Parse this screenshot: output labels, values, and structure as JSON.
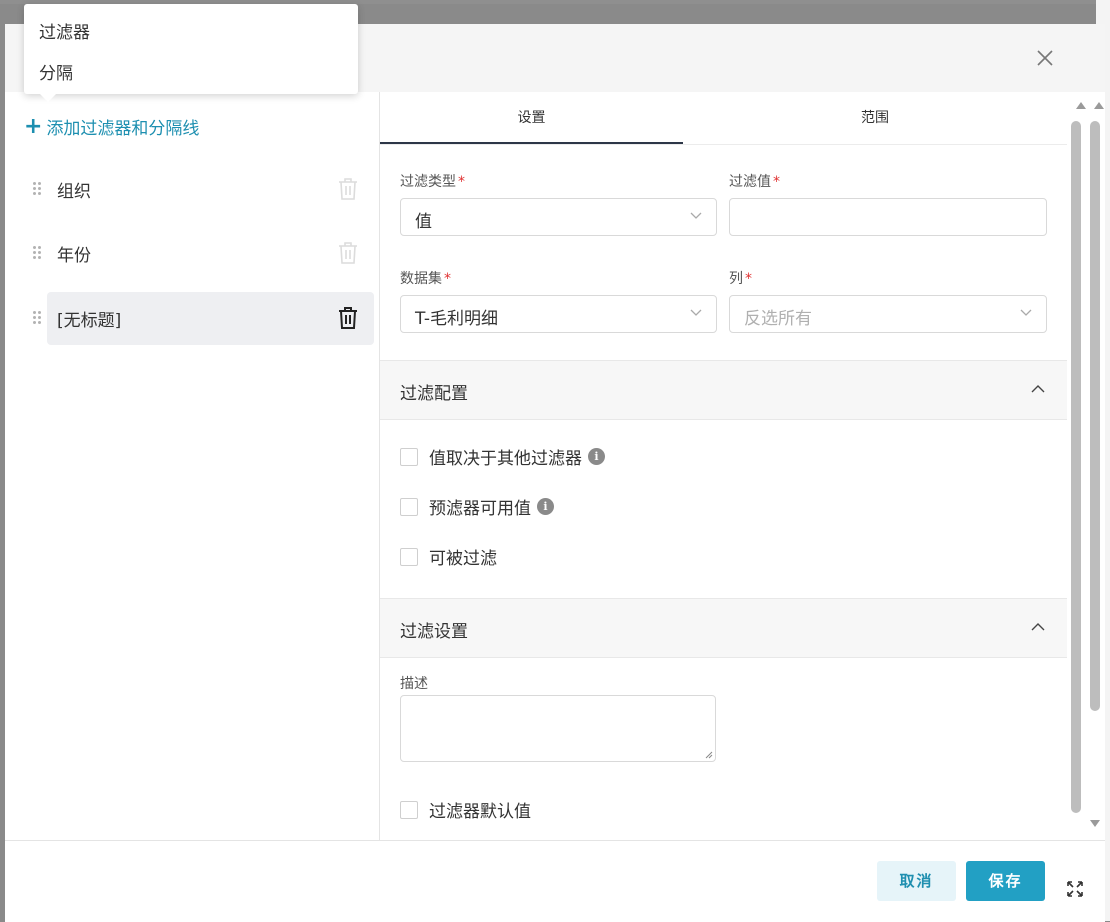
{
  "dialog": {
    "left_panel": {
      "add_link": "添加过滤器和分隔线",
      "items": [
        {
          "label": "组织"
        },
        {
          "label": "年份"
        },
        {
          "label": "[无标题]"
        }
      ]
    },
    "tabs": [
      {
        "label": "设置",
        "active": true
      },
      {
        "label": "范围",
        "active": false
      }
    ],
    "form": {
      "filter_type": {
        "label": "过滤类型",
        "required": "*",
        "value": "值"
      },
      "filter_value": {
        "label": "过滤值",
        "required": "*",
        "value": ""
      },
      "dataset": {
        "label": "数据集",
        "required": "*",
        "value": "T-毛利明细"
      },
      "column": {
        "label": "列",
        "required": "*",
        "placeholder": "反选所有"
      }
    },
    "filter_config": {
      "title": "过滤配置",
      "options": [
        {
          "label": "值取决于其他过滤器",
          "info": true,
          "checked": false
        },
        {
          "label": "预滤器可用值",
          "info": true,
          "checked": false
        },
        {
          "label": "可被过滤",
          "info": false,
          "checked": false
        }
      ]
    },
    "filter_settings": {
      "title": "过滤设置",
      "description_label": "描述",
      "default_value_label": "过滤器默认值"
    },
    "footer": {
      "cancel": "取消",
      "save": "保存"
    }
  },
  "dropdown_menu": {
    "items": [
      "过滤器",
      "分隔"
    ]
  },
  "colors": {
    "accent": "#22a0c4",
    "link": "#1d8fb0",
    "required": "#e03131"
  }
}
